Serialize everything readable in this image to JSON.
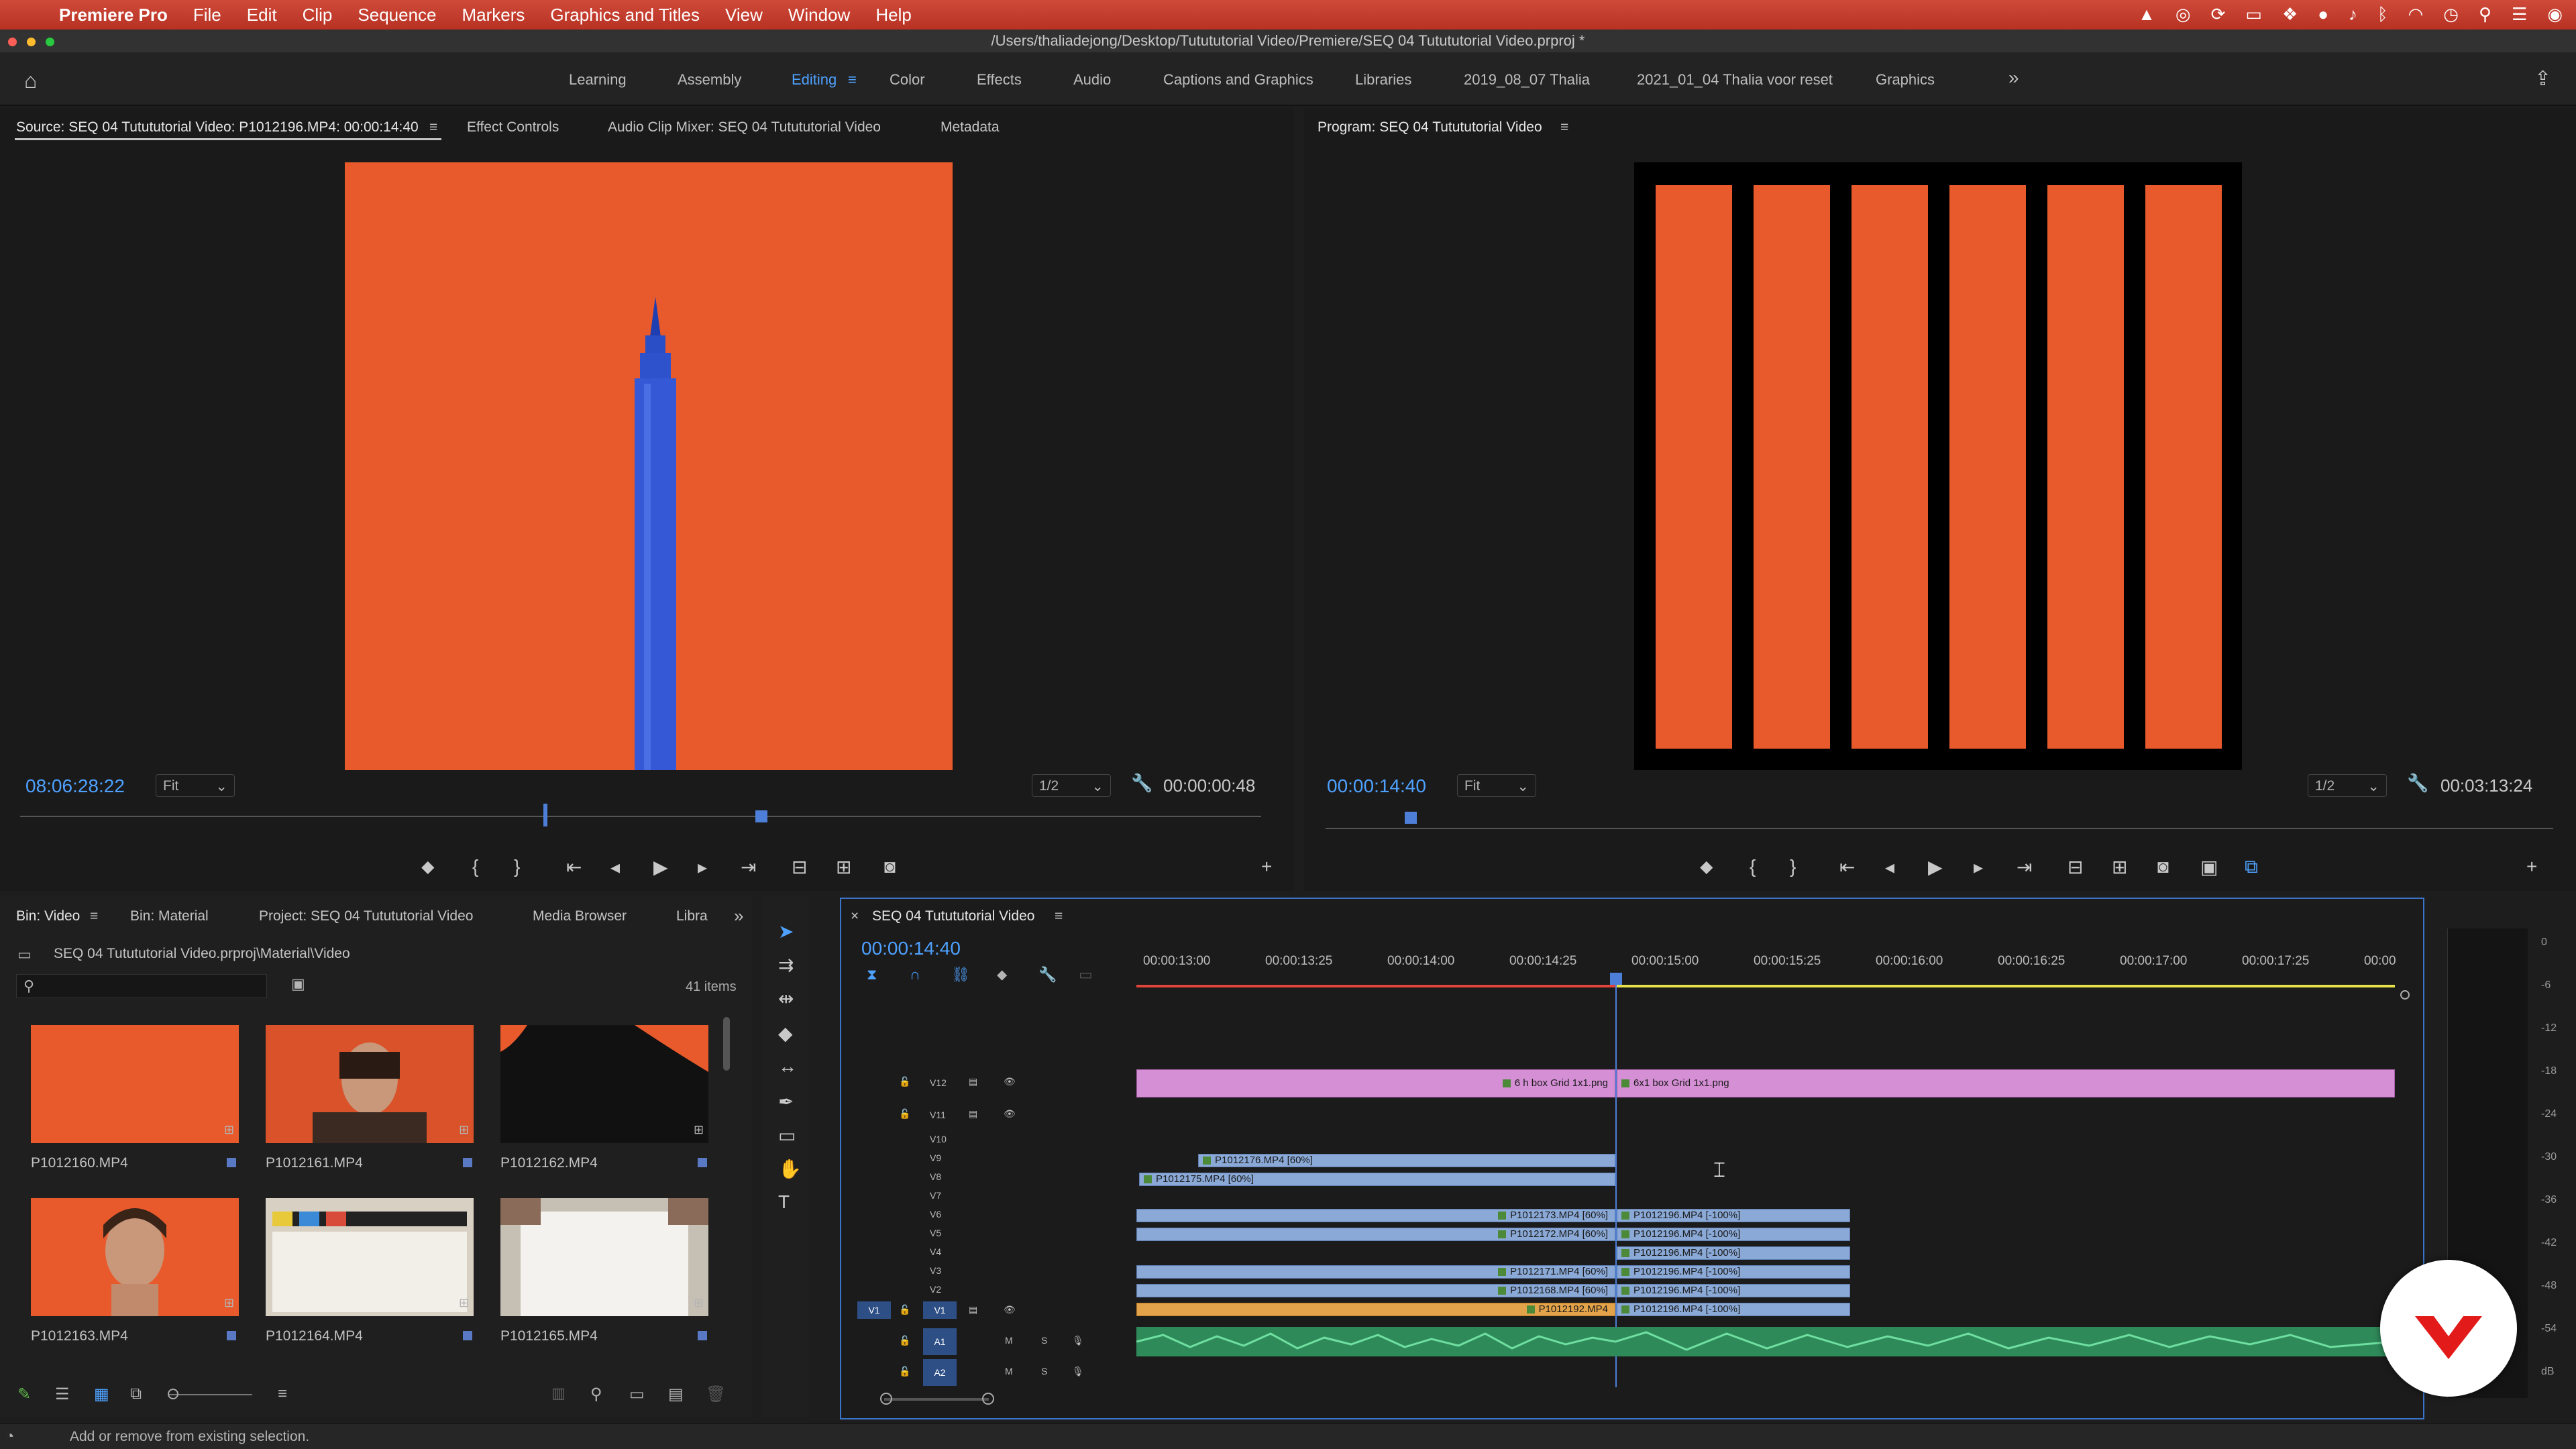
{
  "menubar": {
    "app": "Premiere Pro",
    "items": [
      "File",
      "Edit",
      "Clip",
      "Sequence",
      "Markers",
      "Graphics and Titles",
      "View",
      "Window",
      "Help"
    ]
  },
  "title_path": "/Users/thaliadejong/Desktop/Tutututorial Video/Premiere/SEQ 04 Tutututorial Video.prproj *",
  "workspaces": [
    "Learning",
    "Assembly",
    "Editing",
    "Color",
    "Effects",
    "Audio",
    "Captions and Graphics",
    "Libraries",
    "2019_08_07 Thalia",
    "2021_01_04 Thalia voor reset",
    "Graphics"
  ],
  "source": {
    "tab": "Source: SEQ 04 Tutututorial Video: P1012196.MP4: 00:00:14:40",
    "tabs": [
      "Effect Controls",
      "Audio Clip Mixer: SEQ 04 Tutututorial Video",
      "Metadata"
    ],
    "timecode": "08:06:28:22",
    "fit": "Fit",
    "res": "1/2",
    "duration": "00:00:00:48"
  },
  "program": {
    "tab": "Program: SEQ 04 Tutututorial Video",
    "timecode": "00:00:14:40",
    "fit": "Fit",
    "res": "1/2",
    "duration": "00:03:13:24"
  },
  "project": {
    "tabs": [
      "Bin: Video",
      "Bin: Material",
      "Project: SEQ 04 Tutututorial Video",
      "Media Browser",
      "Libra"
    ],
    "path": "SEQ 04 Tutututorial Video.prproj\\Material\\Video",
    "count": "41 items",
    "items": [
      "P1012160.MP4",
      "P1012161.MP4",
      "P1012162.MP4",
      "P1012163.MP4",
      "P1012164.MP4",
      "P1012165.MP4"
    ]
  },
  "timeline": {
    "tab": "SEQ 04 Tutututorial Video",
    "timecode": "00:00:14:40",
    "ruler": [
      "00:00:13:00",
      "00:00:13:25",
      "00:00:14:00",
      "00:00:14:25",
      "00:00:15:00",
      "00:00:15:25",
      "00:00:16:00",
      "00:00:16:25",
      "00:00:17:00",
      "00:00:17:25",
      "00:00"
    ],
    "tracks": [
      "V12",
      "V11",
      "V10",
      "V9",
      "V8",
      "V7",
      "V6",
      "V5",
      "V4",
      "V3",
      "V2",
      "V1",
      "A1",
      "A2"
    ],
    "clips": {
      "v12a": "6 h box Grid 1x1.png",
      "v12b": "6x1 box Grid 1x1.png",
      "v9": "P1012176.MP4 [60%]",
      "v8": "P1012175.MP4 [60%]",
      "v6a": "P1012173.MP4 [60%]",
      "v6b": "P1012196.MP4 [-100%]",
      "v5a": "P1012172.MP4 [60%]",
      "v5b": "P1012196.MP4 [-100%]",
      "v4b": "P1012196.MP4 [-100%]",
      "v3a": "P1012171.MP4 [60%]",
      "v3b": "P1012196.MP4 [-100%]",
      "v2a": "P1012168.MP4 [60%]",
      "v2b": "P1012196.MP4 [-100%]",
      "v1a": "P1012192.MP4",
      "v1b": "P1012196.MP4 [-100%]"
    }
  },
  "meter": [
    "0",
    "-6",
    "-12",
    "-18",
    "-24",
    "-30",
    "-36",
    "-42",
    "-48",
    "-54",
    "dB"
  ],
  "status": "Add or remove from existing selection.",
  "colors": {
    "accent": "#4ea1ff",
    "orange": "#e85a2c",
    "menubar": "#c0392b"
  }
}
